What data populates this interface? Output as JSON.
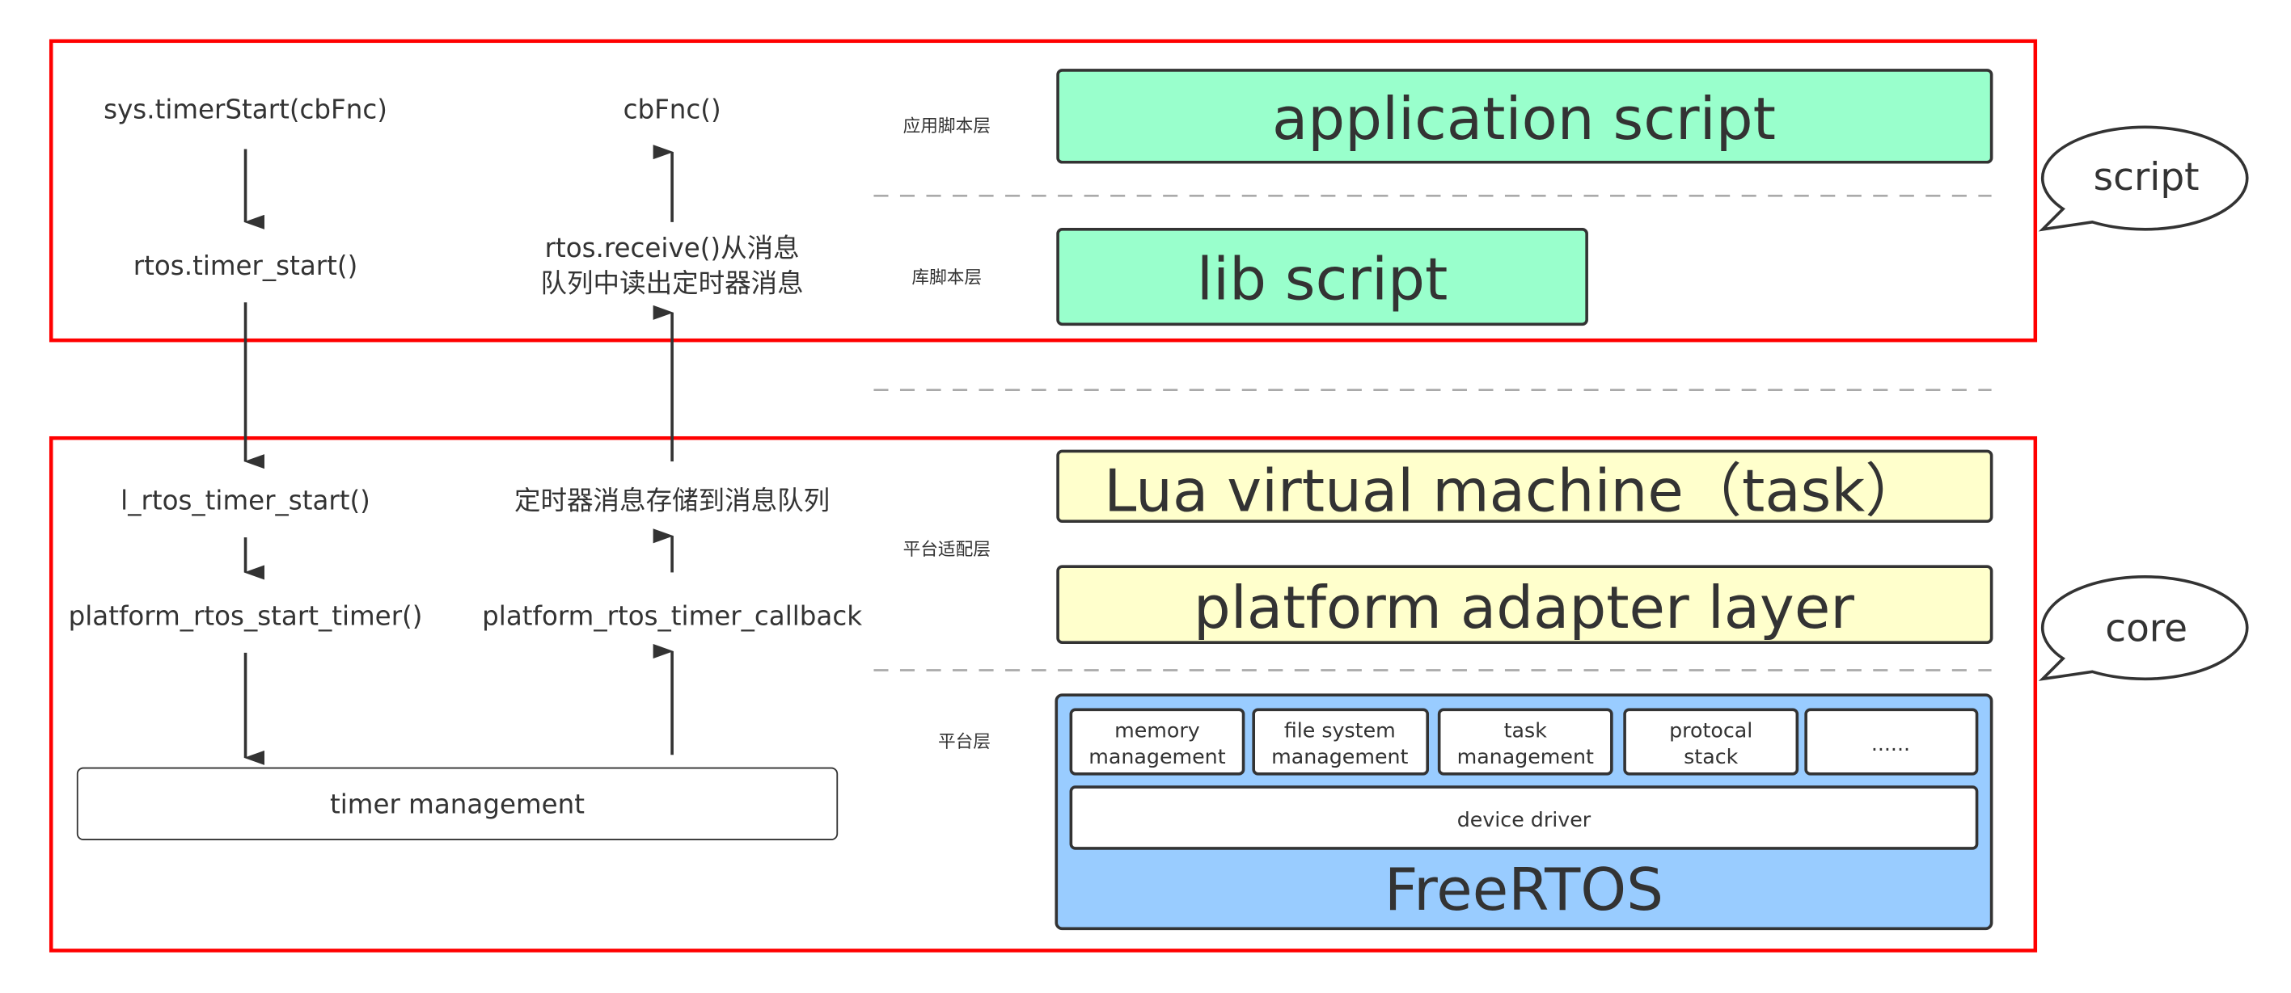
{
  "colors": {
    "frame": "#ff0000",
    "script_layer": "#99ffcc",
    "adapter_layer": "#ffffcc",
    "rtos_layer": "#99ccff"
  },
  "left_flow": {
    "sys_timer_start": "sys.timerStart(cbFnc)",
    "rtos_timer_start": "rtos.timer_start()",
    "l_rtos_timer_start": "l_rtos_timer_start()",
    "platform_start_timer": "platform_rtos_start_timer()",
    "timer_management": "timer management"
  },
  "right_flow": {
    "cbfnc": "cbFnc()",
    "receive_line1": "rtos.receive()从消息",
    "receive_line2": "队列中读出定时器消息",
    "store_queue": "定时器消息存储到消息队列",
    "platform_callback": "platform_rtos_timer_callback"
  },
  "layer_labels": {
    "app": "应用脚本层",
    "lib": "库脚本层",
    "adapter": "平台适配层",
    "platform": "平台层"
  },
  "layers": {
    "application_script": "application script",
    "lib_script": "lib script",
    "lua_vm": "Lua virtual machine（task）",
    "platform_adapter": "platform adapter layer",
    "freertos": "FreeRTOS",
    "modules": [
      [
        "memory",
        "management"
      ],
      [
        "file system",
        "management"
      ],
      [
        "task",
        "management"
      ],
      [
        "protocal",
        "stack"
      ],
      [
        "......"
      ]
    ],
    "device_driver": "device driver"
  },
  "callouts": {
    "script": "script",
    "core": "core"
  }
}
